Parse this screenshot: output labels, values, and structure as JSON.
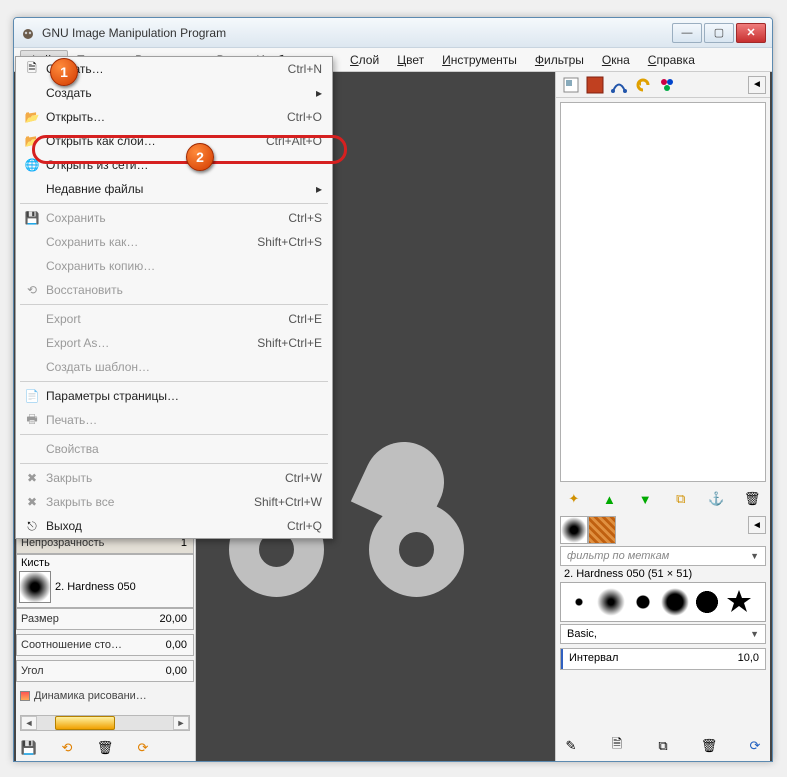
{
  "window": {
    "title": "GNU Image Manipulation Program"
  },
  "menubar": {
    "items": [
      {
        "label": "Файл",
        "mnemonic": "Ф"
      },
      {
        "label": "Правка",
        "mnemonic": "П"
      },
      {
        "label": "Выделение",
        "mnemonic": "В"
      },
      {
        "label": "Вид",
        "mnemonic": "В"
      },
      {
        "label": "Изображение",
        "mnemonic": "И"
      },
      {
        "label": "Слой",
        "mnemonic": "С"
      },
      {
        "label": "Цвет",
        "mnemonic": "Ц"
      },
      {
        "label": "Инструменты",
        "mnemonic": "И"
      },
      {
        "label": "Фильтры",
        "mnemonic": "Ф"
      },
      {
        "label": "Окна",
        "mnemonic": "О"
      },
      {
        "label": "Справка",
        "mnemonic": "С"
      }
    ]
  },
  "file_menu": {
    "items": [
      {
        "label": "Создать…",
        "shortcut": "Ctrl+N",
        "icon": "new"
      },
      {
        "label": "Создать",
        "shortcut": "",
        "submenu": true
      },
      {
        "label": "Открыть…",
        "shortcut": "Ctrl+O",
        "icon": "folder"
      },
      {
        "label": "Открыть как слои…",
        "shortcut": "Ctrl+Alt+O",
        "icon": "folder-layers"
      },
      {
        "label": "Открыть из сети…",
        "shortcut": "",
        "icon": "globe"
      },
      {
        "label": "Недавние файлы",
        "shortcut": "",
        "submenu": true
      },
      {
        "sep": true
      },
      {
        "label": "Сохранить",
        "shortcut": "Ctrl+S",
        "icon": "save",
        "disabled": true
      },
      {
        "label": "Сохранить как…",
        "shortcut": "Shift+Ctrl+S",
        "disabled": true
      },
      {
        "label": "Сохранить копию…",
        "shortcut": "",
        "disabled": true
      },
      {
        "label": "Восстановить",
        "shortcut": "",
        "icon": "revert",
        "disabled": true
      },
      {
        "sep": true
      },
      {
        "label": "Export",
        "shortcut": "Ctrl+E",
        "disabled": true
      },
      {
        "label": "Export As…",
        "shortcut": "Shift+Ctrl+E",
        "disabled": true
      },
      {
        "label": "Создать шаблон…",
        "shortcut": "",
        "disabled": true
      },
      {
        "sep": true
      },
      {
        "label": "Параметры страницы…",
        "shortcut": "",
        "icon": "page"
      },
      {
        "label": "Печать…",
        "shortcut": "",
        "icon": "print",
        "disabled": true
      },
      {
        "sep": true
      },
      {
        "label": "Свойства",
        "shortcut": "",
        "disabled": true
      },
      {
        "sep": true
      },
      {
        "label": "Закрыть",
        "shortcut": "Ctrl+W",
        "icon": "close",
        "disabled": true
      },
      {
        "label": "Закрыть все",
        "shortcut": "Shift+Ctrl+W",
        "icon": "close",
        "disabled": true
      },
      {
        "label": "Выход",
        "shortcut": "Ctrl+Q",
        "icon": "exit"
      }
    ]
  },
  "callouts": {
    "one": "1",
    "two": "2"
  },
  "tool_options": {
    "opacity_label": "Непрозрачность",
    "opacity_value": "1",
    "brush_label": "Кисть",
    "brush_name": "2. Hardness 050",
    "size_label": "Размер",
    "size_value": "20,00",
    "aspect_label": "Соотношение сто…",
    "aspect_value": "0,00",
    "angle_label": "Угол",
    "angle_value": "0,00",
    "dynamics_label": "Динамика рисовани…"
  },
  "brush_panel": {
    "filter_placeholder": "фильтр по меткам",
    "info": "2. Hardness 050 (51 × 51)",
    "preset_label": "Basic,",
    "spacing_label": "Интервал",
    "spacing_value": "10,0"
  }
}
